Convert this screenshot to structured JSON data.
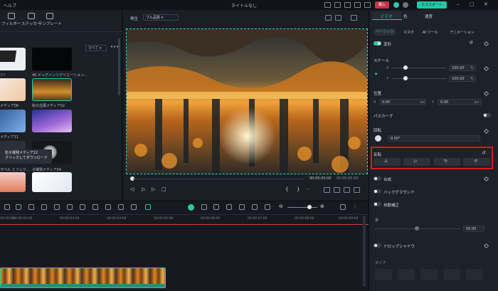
{
  "titlebar": {
    "menu_help": "ヘルプ",
    "title": "タイトルなし",
    "buy_label": "購入",
    "export_label": "エクスポート"
  },
  "toolbar": {
    "filter": "フィルター",
    "sticker": "ステッカー",
    "template": "テンプレート"
  },
  "media": {
    "sort_label": "すべて",
    "items": [
      {
        "label": "ツ！"
      },
      {
        "label": "4K ビッグバンリクリエーション..."
      },
      {
        "label": "メディア06"
      },
      {
        "label": "秋の古風メディア02"
      },
      {
        "label": "メディア11"
      },
      {
        "label": "ラベル エフェク..."
      },
      {
        "label": "子爆発メディア04"
      }
    ],
    "tooltip_line1": "粒子爆発メディア12",
    "tooltip_line2": "クリックしてダウンロード"
  },
  "preview": {
    "play_label": "再生",
    "quality": "フル品質",
    "time_current": "00:00:00:00",
    "time_total": "00:00:05:00"
  },
  "properties": {
    "tabs": [
      "ビデオ",
      "色",
      "速度"
    ],
    "subtabs": [
      "ベーシック",
      "マスク",
      "AI ツール",
      "アニメーション"
    ],
    "transform_label": "変形",
    "scale_label": "スケール",
    "x_label": "X",
    "y_label": "Y",
    "scale_x": "100.00",
    "scale_y": "100.00",
    "percent": "%",
    "position_label": "位置",
    "pos_x": "0.00",
    "pos_y": "0.00",
    "px": "px",
    "pascope_label": "パスカーブ",
    "rotate_label": "回転",
    "rotate_value": "0.00°",
    "flip_label": "反転",
    "composite_label": "合成",
    "background_label": "バックグラウンド",
    "auto_enhance_label": "自動補正",
    "amount_label": "量",
    "amount_value": "50.00",
    "drop_shadow_label": "ドロップシャドウ",
    "type_label": "タイプ"
  },
  "timeline": {
    "ruler": [
      "00:00:00",
      "00:00:02:00",
      "00:00:03:00",
      "00:00:04:00",
      "00:00:05:00",
      "00:00:06:00",
      "00:00:07:00",
      "00:00:08:00",
      "00:00:09:00"
    ]
  },
  "colors": {
    "accent": "#2ec7a8",
    "highlight_box": "#e01818",
    "buy": "#c8324a"
  }
}
